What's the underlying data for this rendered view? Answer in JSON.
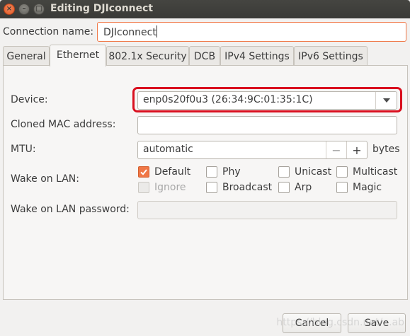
{
  "window": {
    "title": "Editing DJIconnect",
    "close_glyph": "×",
    "minimize_glyph": "–",
    "maximize_glyph": "□"
  },
  "connection": {
    "label": "Connection name:",
    "value": "DJIconnect"
  },
  "tabs": [
    {
      "label": "General",
      "active": false
    },
    {
      "label": "Ethernet",
      "active": true
    },
    {
      "label": "802.1x Security",
      "active": false
    },
    {
      "label": "DCB",
      "active": false
    },
    {
      "label": "IPv4 Settings",
      "active": false
    },
    {
      "label": "IPv6 Settings",
      "active": false
    }
  ],
  "ethernet": {
    "device_label": "Device:",
    "device_value": "enp0s20f0u3 (26:34:9C:01:35:1C)",
    "cloned_mac_label": "Cloned MAC address:",
    "cloned_mac_value": "",
    "mtu_label": "MTU:",
    "mtu_value": "automatic",
    "mtu_minus": "−",
    "mtu_plus": "+",
    "mtu_unit": "bytes",
    "wol_label": "Wake on LAN:",
    "wol_options": [
      {
        "label": "Default",
        "checked": true,
        "disabled": false
      },
      {
        "label": "Phy",
        "checked": false,
        "disabled": false
      },
      {
        "label": "Unicast",
        "checked": false,
        "disabled": false
      },
      {
        "label": "Multicast",
        "checked": false,
        "disabled": false
      },
      {
        "label": "Ignore",
        "checked": false,
        "disabled": true
      },
      {
        "label": "Broadcast",
        "checked": false,
        "disabled": false
      },
      {
        "label": "Arp",
        "checked": false,
        "disabled": false
      },
      {
        "label": "Magic",
        "checked": false,
        "disabled": false
      }
    ],
    "wol_password_label": "Wake on LAN password:",
    "wol_password_value": ""
  },
  "buttons": {
    "cancel": "Cancel",
    "save": "Save"
  },
  "watermark": "https://blog.csdn.net/...ab",
  "colors": {
    "accent": "#f07746",
    "highlight": "#d9101f",
    "titlebar": "#3c3b37"
  }
}
